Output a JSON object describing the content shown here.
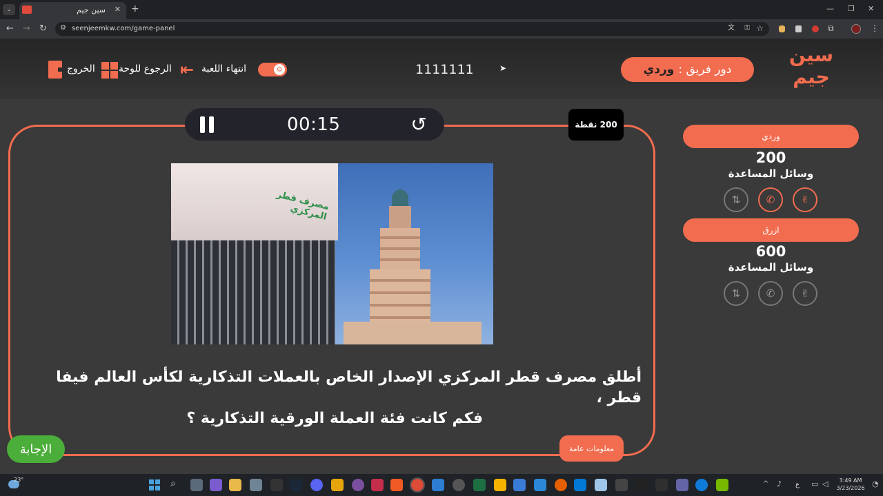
{
  "browser": {
    "tab_title": "سين جيم",
    "url": "seenjeemkw.com/game-panel",
    "new_tab": "+",
    "window": {
      "min": "—",
      "restore": "❐",
      "close": "✕"
    }
  },
  "header": {
    "logo_line1": "سين",
    "logo_line2": "جيم",
    "turn_label": "دور فريق :",
    "turn_team": "وردي",
    "game_code": "1111111",
    "end_game": "انتهاء اللعبة",
    "back_to_board": "الرجوع للوحة",
    "exit": "الخروج"
  },
  "timer": {
    "time": "00:15"
  },
  "question": {
    "points": "200 نقطة",
    "line1": "أطلق مصرف قطر المركزي الإصدار الخاص بالعملات التذكارية لكأس العالم فيفا قطر ،",
    "line2": "فكم كانت فئة العملة الورقية التذكارية ؟",
    "category": "معلومات عامة",
    "answer_button": "الإجابة",
    "image_sign": "مصرف قطر المركزي"
  },
  "teams": [
    {
      "name": "وردي",
      "score": "200",
      "helpers_label": "وسائل المساعدة",
      "helpers_active": [
        true,
        true,
        false
      ]
    },
    {
      "name": "ازرق",
      "score": "600",
      "helpers_label": "وسائل المساعدة",
      "helpers_active": [
        false,
        false,
        false
      ]
    }
  ],
  "taskbar": {
    "weather": "23°",
    "time": "3:49 AM",
    "date": "3/23/2026",
    "lang": "ع"
  },
  "colors": {
    "accent": "#f26c4f",
    "answer": "#4cae3a",
    "bg": "#3a3a3a"
  }
}
